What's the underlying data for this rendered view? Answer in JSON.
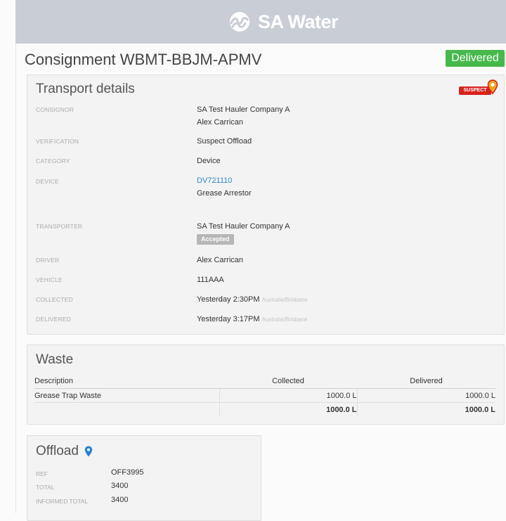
{
  "brand": {
    "name": "SA Water"
  },
  "consignment": {
    "title": "Consignment WBMT-BBJM-APMV",
    "status": "Delivered"
  },
  "transport": {
    "heading": "Transport details",
    "suspect_badge": "SUSPECT",
    "rows": {
      "consignor": {
        "label": "CONSIGNOR",
        "line1": "SA Test Hauler Company A",
        "line2": "Alex Carrican"
      },
      "verification": {
        "label": "VERIFICATION",
        "value": "Suspect Offload"
      },
      "category": {
        "label": "CATEGORY",
        "value": "Device"
      },
      "device": {
        "label": "DEVICE",
        "id": "DV721110",
        "type": "Grease Arrestor"
      },
      "transporter": {
        "label": "TRANSPORTER",
        "value": "SA Test Hauler Company A",
        "badge": "Accepted"
      },
      "driver": {
        "label": "DRIVER",
        "value": "Alex Carrican"
      },
      "vehicle": {
        "label": "VEHICLE",
        "value": "111AAA"
      },
      "collected": {
        "label": "COLLECTED",
        "value": "Yesterday 2:30PM",
        "tz": "Australia/Brisbane"
      },
      "delivered": {
        "label": "DELIVERED",
        "value": "Yesterday 3:17PM",
        "tz": "Australia/Brisbane"
      }
    }
  },
  "waste": {
    "heading": "Waste",
    "columns": [
      "Description",
      "Collected",
      "Delivered"
    ],
    "rows": [
      {
        "description": "Grease Trap Waste",
        "collected": "1000.0 L",
        "delivered": "1000.0 L"
      }
    ],
    "totals": {
      "collected": "1000.0 L",
      "delivered": "1000.0 L"
    }
  },
  "offload": {
    "heading": "Offload",
    "rows": {
      "ref": {
        "label": "REF",
        "value": "OFF3995"
      },
      "total": {
        "label": "TOTAL",
        "value": "3400"
      },
      "informed_total": {
        "label": "INFORMED TOTAL",
        "value": "3400"
      }
    }
  },
  "colors": {
    "topbar": "#c9ced6",
    "delivered_badge": "#47b94c",
    "link": "#2f86c8",
    "suspect": "#d8231d",
    "pin": "#2a7fd4"
  }
}
